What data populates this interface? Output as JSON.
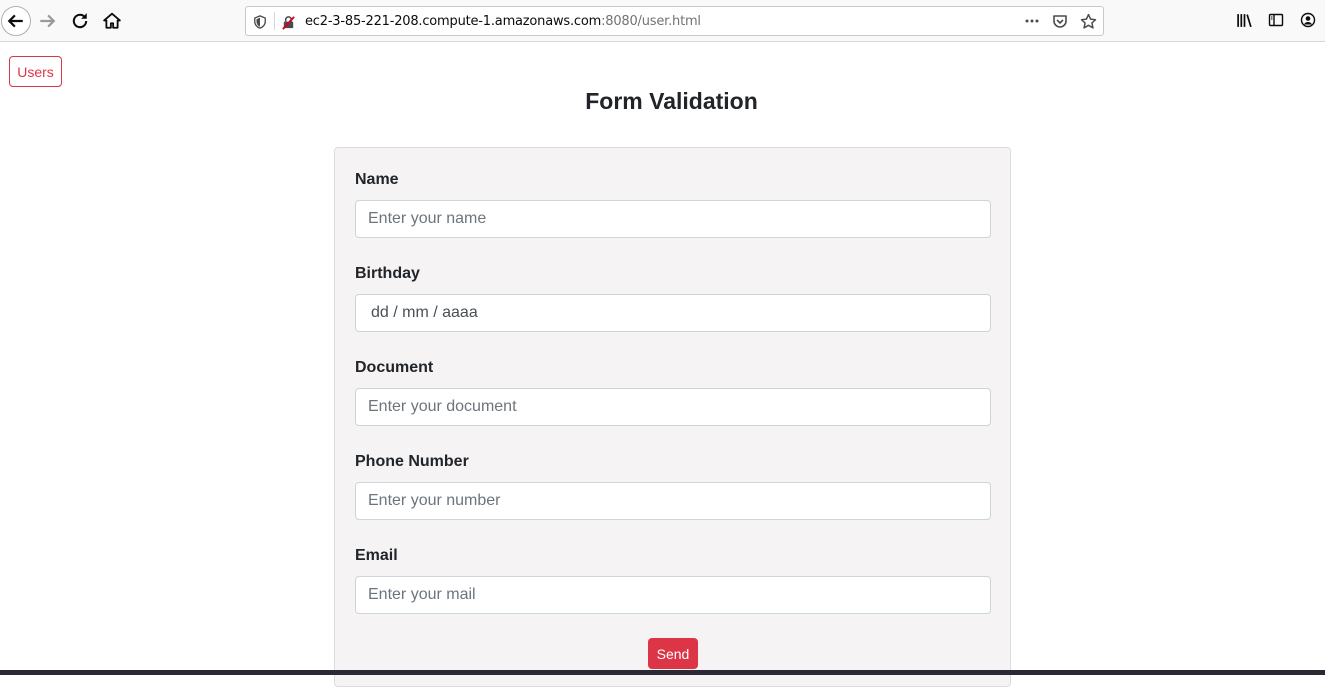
{
  "browser": {
    "url_host": "ec2-3-85-221-208.compute-1.amazonaws.com",
    "url_path": ":8080/user.html",
    "icons": [
      "back-icon",
      "forward-icon",
      "reload-icon",
      "home-icon",
      "shield-icon",
      "insecure-connection-icon",
      "more-icon",
      "pocket-icon",
      "bookmark-star-icon",
      "library-icon",
      "sidebar-icon",
      "account-icon"
    ]
  },
  "page": {
    "users_button": "Users",
    "title": "Form Validation",
    "accent_color": "#dc3545"
  },
  "form": {
    "name": {
      "label": "Name",
      "placeholder": "Enter your name"
    },
    "birthday": {
      "label": "Birthday",
      "placeholder": "dd / mm / aaaa"
    },
    "document": {
      "label": "Document",
      "placeholder": "Enter your document"
    },
    "phone": {
      "label": "Phone Number",
      "placeholder": "Enter your number"
    },
    "email": {
      "label": "Email",
      "placeholder": "Enter your mail"
    },
    "submit_label": "Send"
  }
}
